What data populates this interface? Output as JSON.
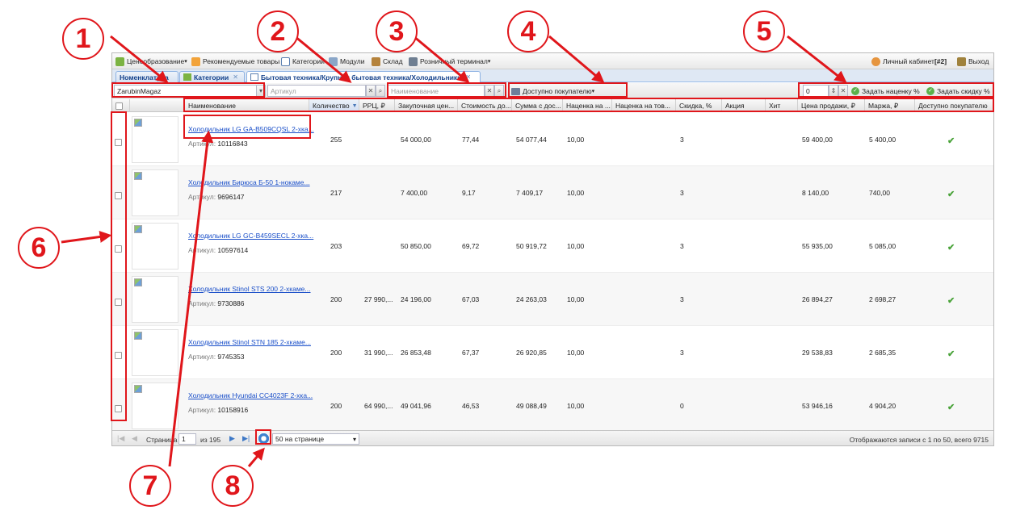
{
  "menu": {
    "items": [
      {
        "label": "Ценообразование",
        "dropdown": true
      },
      {
        "label": "Рекомендуемые товары",
        "dropdown": false
      },
      {
        "label": "Категории",
        "dropdown": false
      },
      {
        "label": "Модули",
        "dropdown": false
      },
      {
        "label": "Склад",
        "dropdown": false
      },
      {
        "label": "Розничный терминал",
        "dropdown": true
      }
    ],
    "account_prefix": "Личный кабинет ",
    "account_id": "[#2]",
    "logout": "Выход"
  },
  "tabs": [
    {
      "label": "Номенклатура",
      "closable": false,
      "active": false
    },
    {
      "label": "Категории",
      "closable": true,
      "active": false
    },
    {
      "label": "Бытовая техника/Крупная бытовая техника/Холодильники",
      "closable": true,
      "active": true
    }
  ],
  "toolbar": {
    "store_value": "ZarubinMagaz",
    "article_placeholder": "Артикул",
    "name_placeholder": "Наименование",
    "availability_label": "Доступно покупателю",
    "percent_value": "0",
    "set_markup_label": "Задать наценку %",
    "set_discount_label": "Задать скидку %"
  },
  "columns": [
    "Наименование",
    "Количество",
    "РРЦ, ₽",
    "Закупочная цен...",
    "Стоимость до...",
    "Сумма с дос...",
    "Наценка на ...",
    "Наценка на тов...",
    "Скидка, %",
    "Акция",
    "Хит",
    "Цена продажи, ₽",
    "Маржа, ₽",
    "Доступно покупателю"
  ],
  "article_label": "Артикул: ",
  "rows": [
    {
      "name": "Холодильник LG GA-B509CQSL 2-хка...",
      "article": "10116843",
      "qty": "255",
      "rrp": "",
      "purchase": "54 000,00",
      "delivery": "77,44",
      "sum": "54 077,44",
      "markup": "10,00",
      "discount": "3",
      "price": "59 400,00",
      "margin": "5 400,00",
      "available": true
    },
    {
      "name": "Холодильник Бирюса Б-50 1-нокаме...",
      "article": "9696147",
      "qty": "217",
      "rrp": "",
      "purchase": "7 400,00",
      "delivery": "9,17",
      "sum": "7 409,17",
      "markup": "10,00",
      "discount": "3",
      "price": "8 140,00",
      "margin": "740,00",
      "available": true
    },
    {
      "name": "Холодильник LG GC-B459SECL 2-хка...",
      "article": "10597614",
      "qty": "203",
      "rrp": "",
      "purchase": "50 850,00",
      "delivery": "69,72",
      "sum": "50 919,72",
      "markup": "10,00",
      "discount": "3",
      "price": "55 935,00",
      "margin": "5 085,00",
      "available": true
    },
    {
      "name": "Холодильник Stinol STS 200 2-хкаме...",
      "article": "9730886",
      "qty": "200",
      "rrp": "27 990,...",
      "purchase": "24 196,00",
      "delivery": "67,03",
      "sum": "24 263,03",
      "markup": "10,00",
      "discount": "3",
      "price": "26 894,27",
      "margin": "2 698,27",
      "available": true
    },
    {
      "name": "Холодильник Stinol STN 185 2-хкаме...",
      "article": "9745353",
      "qty": "200",
      "rrp": "31 990,...",
      "purchase": "26 853,48",
      "delivery": "67,37",
      "sum": "26 920,85",
      "markup": "10,00",
      "discount": "3",
      "price": "29 538,83",
      "margin": "2 685,35",
      "available": true
    },
    {
      "name": "Холодильник Hyundai CC4023F 2-хка...",
      "article": "10158916",
      "qty": "200",
      "rrp": "64 990,...",
      "purchase": "49 041,96",
      "delivery": "46,53",
      "sum": "49 088,49",
      "markup": "10,00",
      "discount": "0",
      "price": "53 946,16",
      "margin": "4 904,20",
      "available": true
    }
  ],
  "pager": {
    "page_label": "Страница",
    "page_value": "1",
    "of_label": "из 195",
    "per_page_value": "50 на странице",
    "summary": "Отображаются записи с 1 по 50, всего 9715"
  },
  "annotations": [
    "1",
    "2",
    "3",
    "4",
    "5",
    "6",
    "7",
    "8"
  ],
  "colors": {
    "annotation_red": "#e0161b",
    "link_blue": "#1a4fc9",
    "tab_text": "#15428b",
    "check_green": "#4aa33a"
  }
}
